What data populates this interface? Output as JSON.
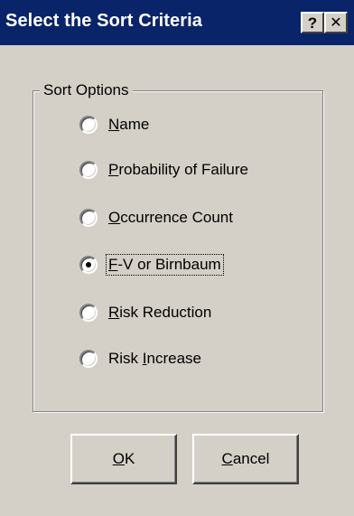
{
  "window": {
    "title": "Select the Sort Criteria",
    "help_glyph": "?",
    "close_glyph": "✕"
  },
  "group": {
    "legend": "Sort Options"
  },
  "options": [
    {
      "label": "Name",
      "mnemonic": "N",
      "selected": false
    },
    {
      "label": "Probability of Failure",
      "mnemonic": "P",
      "selected": false
    },
    {
      "label": "Occurrence Count",
      "mnemonic": "O",
      "selected": false
    },
    {
      "label": "F-V or Birnbaum",
      "mnemonic": "F",
      "selected": true
    },
    {
      "label": "Risk Reduction",
      "mnemonic": "R",
      "selected": false
    },
    {
      "label": "Risk Increase",
      "mnemonic": "I",
      "selected": false
    }
  ],
  "buttons": {
    "ok": "OK",
    "cancel": "Cancel"
  },
  "colors": {
    "titlebar": "#0a246a",
    "face": "#d4d0c8"
  }
}
